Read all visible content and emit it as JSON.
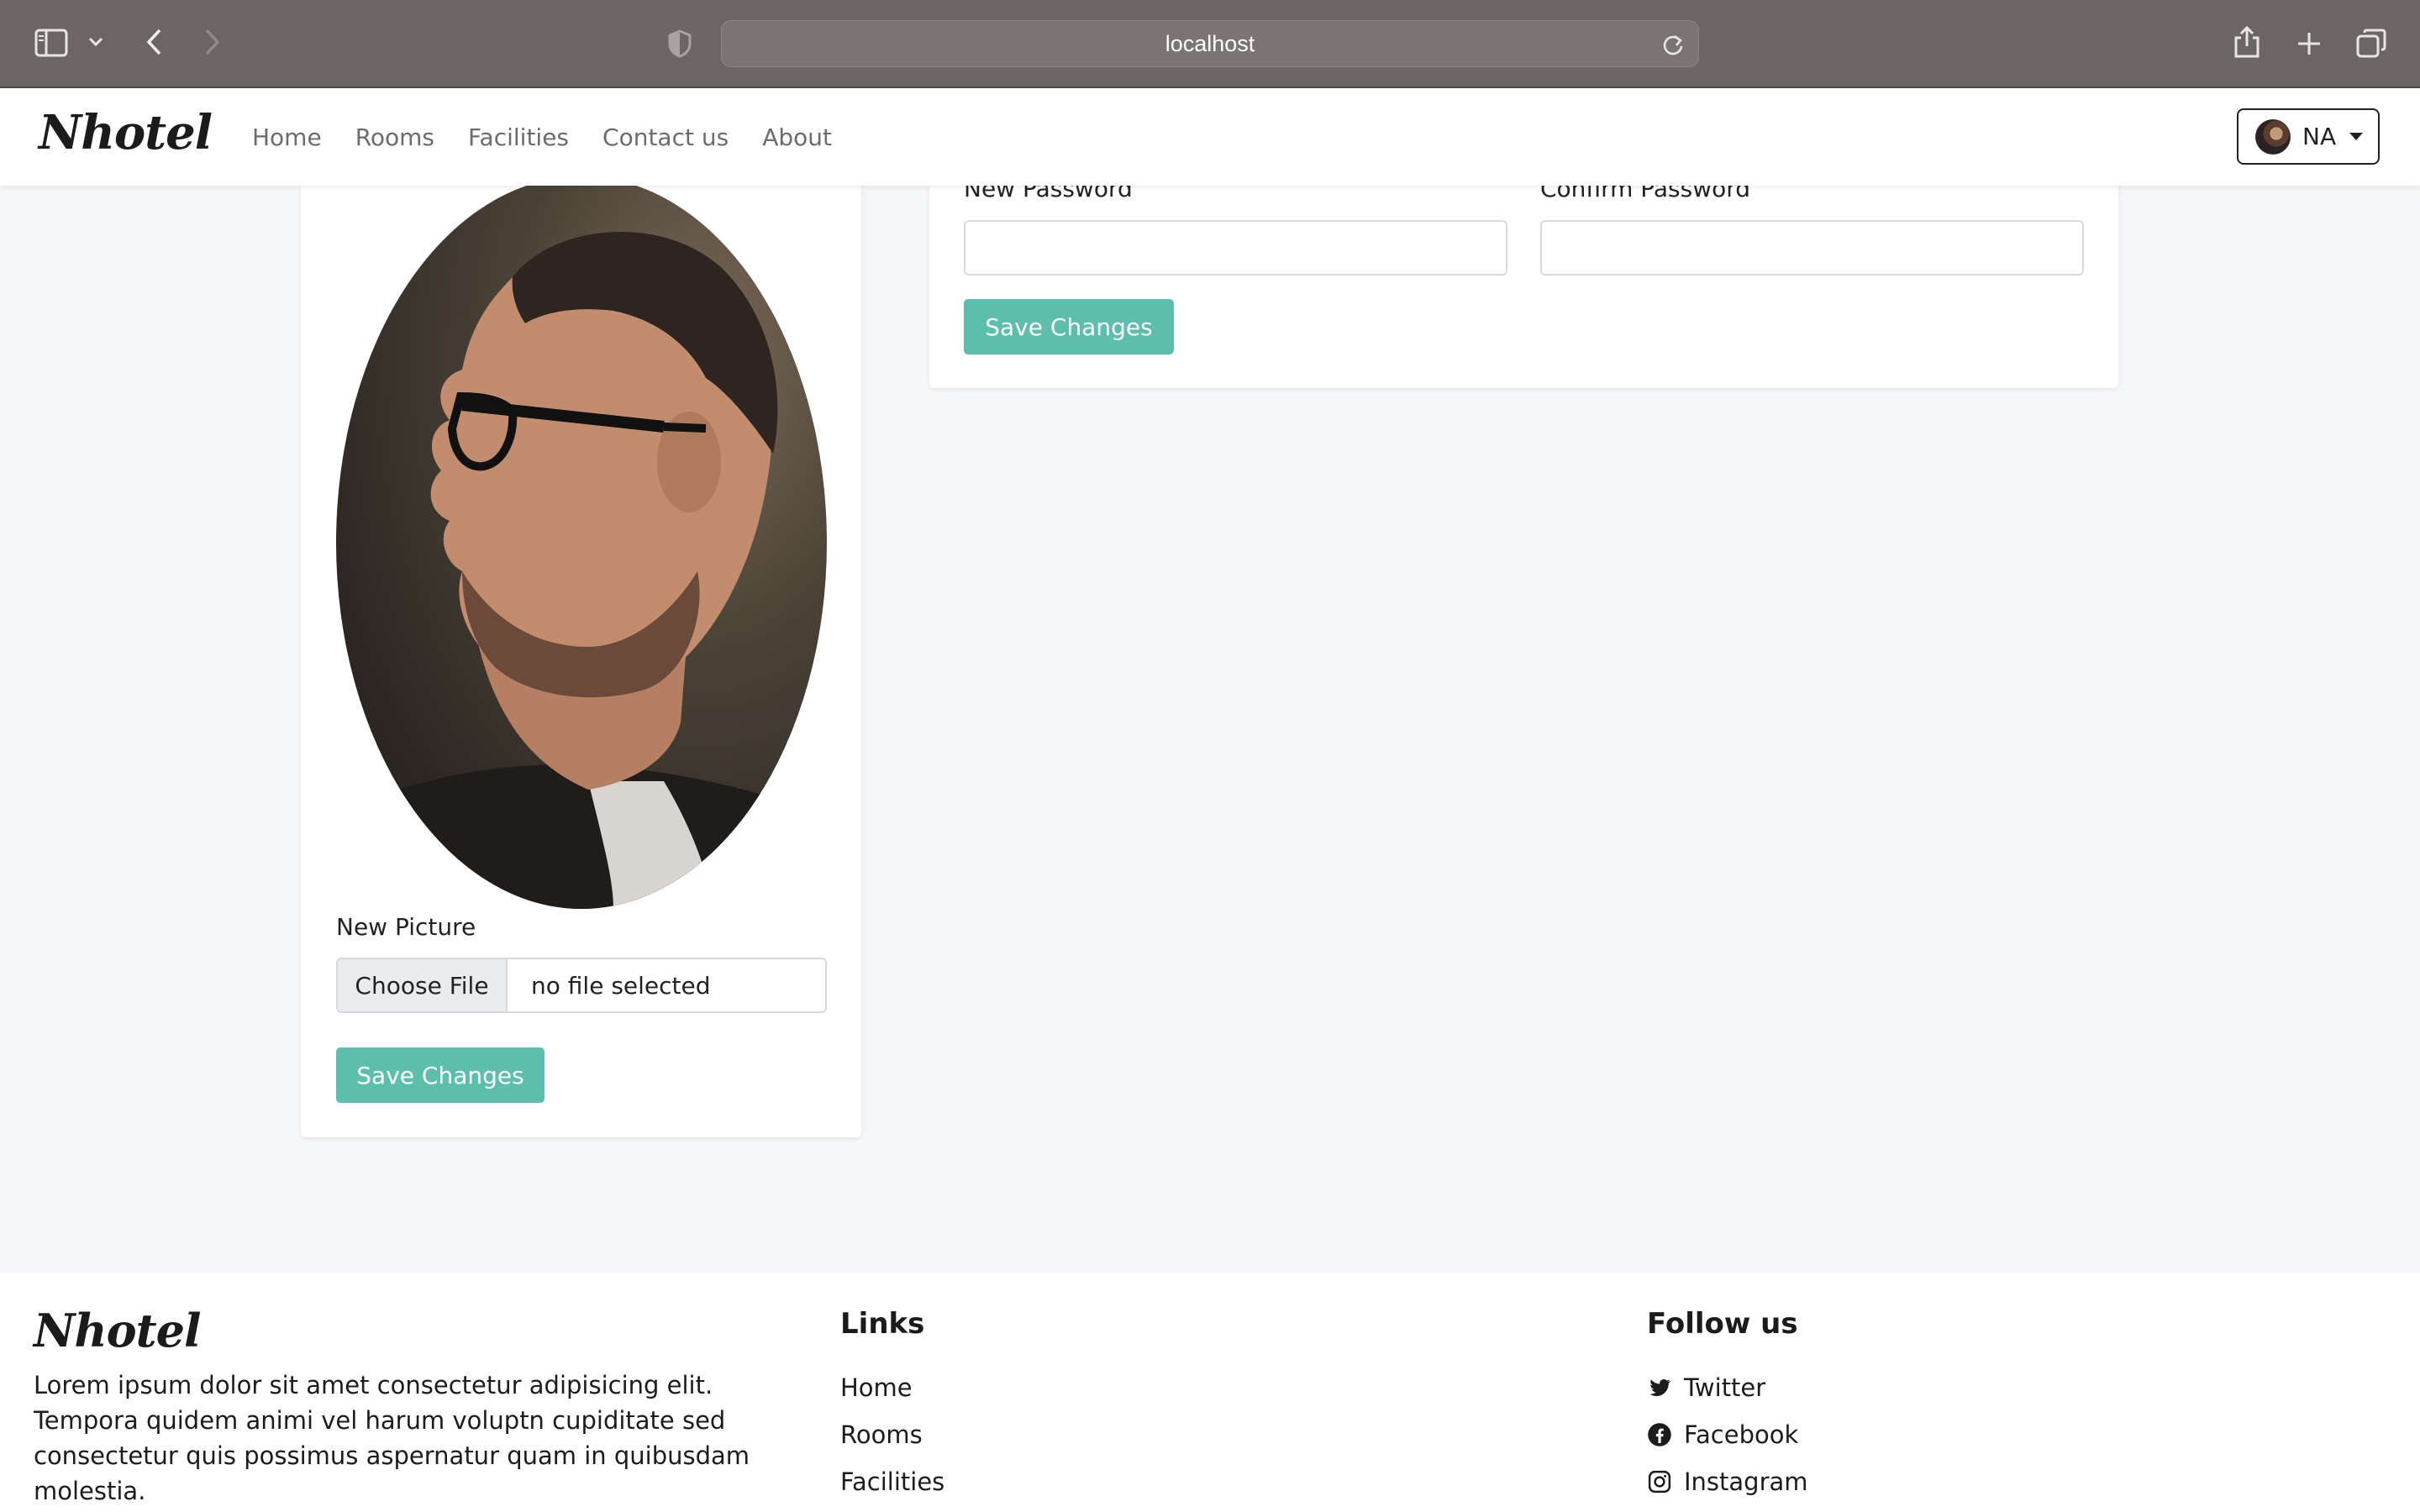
{
  "browser": {
    "url": "localhost"
  },
  "navbar": {
    "brand": "Nhotel",
    "links": [
      "Home",
      "Rooms",
      "Facilities",
      "Contact us",
      "About"
    ],
    "user_initials": "NA"
  },
  "profile_card": {
    "new_picture_label": "New Picture",
    "choose_file_label": "Choose File",
    "file_status": "no file selected",
    "save_label": "Save Changes"
  },
  "password_card": {
    "new_password_label": "New Password",
    "confirm_password_label": "Confirm Password",
    "save_label": "Save Changes"
  },
  "footer": {
    "brand": "Nhotel",
    "description": "Lorem ipsum dolor sit amet consectetur adipisicing elit. Tempora quidem animi vel harum voluptn cupiditate sed consectetur quis possimus aspernatur quam in quibusdam molestia.",
    "links_heading": "Links",
    "links": [
      "Home",
      "Rooms",
      "Facilities"
    ],
    "follow_heading": "Follow us",
    "social": [
      {
        "label": "Twitter",
        "icon": "twitter-icon"
      },
      {
        "label": "Facebook",
        "icon": "facebook-icon"
      },
      {
        "label": "Instagram",
        "icon": "instagram-icon"
      }
    ]
  },
  "colors": {
    "accent": "#5cbfab",
    "page_bg": "#f6f7f8",
    "chrome_bg": "#6b6563"
  }
}
